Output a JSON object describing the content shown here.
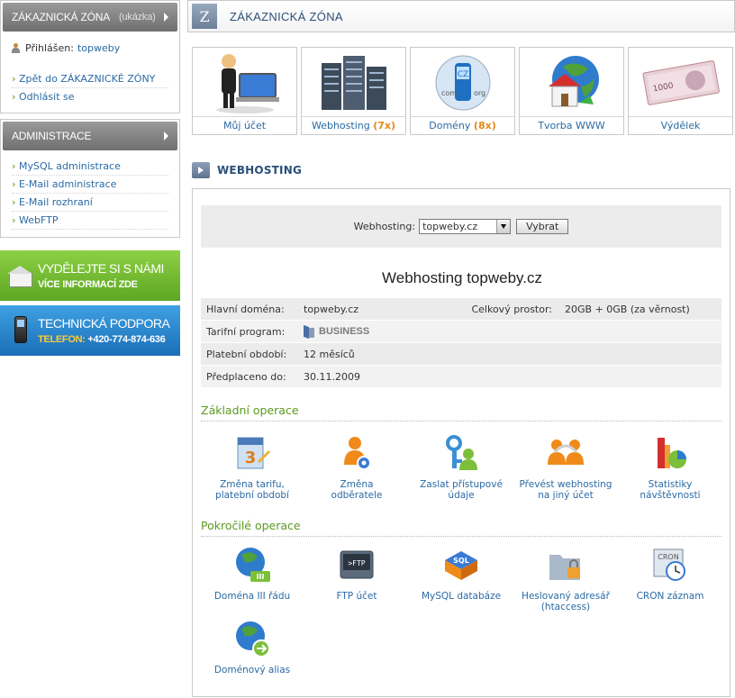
{
  "sidebar": {
    "zone_box": {
      "title": "ZÁKAZNICKÁ ZÓNA",
      "subtitle": "(ukázka)",
      "logged_label": "Přihlášen:",
      "user": "topweby",
      "links": [
        "Zpět do ZÁKAZNICKÉ ZÓNY",
        "Odhlásit se"
      ]
    },
    "admin_box": {
      "title": "ADMINISTRACE",
      "links": [
        "MySQL administrace",
        "E-Mail administrace",
        "E-Mail rozhraní",
        "WebFTP"
      ]
    },
    "banner_earn": {
      "line1": "VYDĚLEJTE SI S NÁMI",
      "line2": "VÍCE INFORMACÍ ZDE"
    },
    "banner_support": {
      "line1": "TECHNICKÁ PODPORA",
      "phone_label": "TELEFON:",
      "phone": "+420-774-874-636"
    }
  },
  "header": {
    "badge": "Z",
    "title": "ZÁKAZNICKÁ ZÓNA"
  },
  "tiles": [
    {
      "label": "Můj účet",
      "count": ""
    },
    {
      "label": "Webhosting",
      "count": "(7x)"
    },
    {
      "label": "Domény",
      "count": "(8x)"
    },
    {
      "label": "Tvorba WWW",
      "count": ""
    },
    {
      "label": "Výdělek",
      "count": ""
    }
  ],
  "tile_pic": {
    "domains_cz": "CZ",
    "domains_com": "com",
    "domains_org": "org",
    "money_value": "1000"
  },
  "section": {
    "title": "WEBHOSTING"
  },
  "selector": {
    "label": "Webhosting:",
    "value": "topweby.cz",
    "button": "Vybrat"
  },
  "hosting_title": "Webhosting topweby.cz",
  "info": {
    "main_domain_label": "Hlavní doména:",
    "main_domain": "topweby.cz",
    "space_label": "Celkový prostor:",
    "space": "20GB + 0GB (za věrnost)",
    "tariff_label": "Tarifní program:",
    "tariff": "BUSINESS",
    "period_label": "Platební období:",
    "period": "12 měsíců",
    "paid_label": "Předplaceno do:",
    "paid": "30.11.2009"
  },
  "basic_ops": {
    "title": "Základní operace",
    "items": [
      [
        "Změna tarifu,",
        "platební období"
      ],
      [
        "Změna",
        "odběratele"
      ],
      [
        "Zaslat přístupové",
        "údaje"
      ],
      [
        "Převést webhosting",
        "na jiný účet"
      ],
      [
        "Statistiky",
        "návštěvnosti"
      ]
    ]
  },
  "advanced_ops": {
    "title": "Pokročilé operace",
    "items": [
      [
        "Doména III řádu",
        ""
      ],
      [
        "FTP účet",
        ""
      ],
      [
        "MySQL databáze",
        ""
      ],
      [
        "Heslovaný adresář",
        "(htaccess)"
      ],
      [
        "CRON záznam",
        ""
      ]
    ],
    "extra": [
      "Doménový alias",
      ""
    ]
  },
  "icon_text": {
    "calendar_num": "3",
    "ftp": ">FTP",
    "sql": "SQL",
    "cron": "CRON",
    "third": "III"
  },
  "colors": {
    "accent_green": "#5b9a1f",
    "link_blue": "#2a6aa5",
    "count_orange": "#e08a1a",
    "heading_blue": "#2b4f78"
  }
}
